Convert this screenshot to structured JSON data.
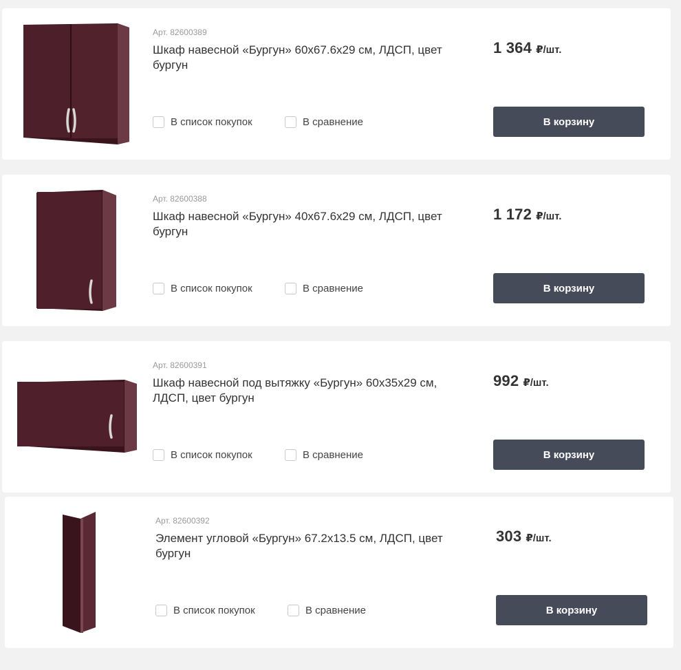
{
  "currency_unit": "₽/шт.",
  "colors": {
    "button_bg": "#464b5a",
    "cabinet": "#4a1e28",
    "page_bg": "#f2f2f2"
  },
  "products": [
    {
      "sku": "Арт. 82600389",
      "title": "Шкаф навесной «Бургун» 60x67.6x29 см, ЛДСП, цвет бургун",
      "price": "1 364",
      "unit": "₽/шт.",
      "shopping_list_label": "В список покупок",
      "compare_label": "В сравнение",
      "cart_button_label": "В корзину",
      "image_icon": "wall-cabinet-double-door-icon"
    },
    {
      "sku": "Арт. 82600388",
      "title": "Шкаф навесной «Бургун» 40x67.6x29 см, ЛДСП, цвет бургун",
      "price": "1 172",
      "unit": "₽/шт.",
      "shopping_list_label": "В список покупок",
      "compare_label": "В сравнение",
      "cart_button_label": "В корзину",
      "image_icon": "wall-cabinet-single-door-icon"
    },
    {
      "sku": "Арт. 82600391",
      "title": "Шкаф навесной под вытяжку «Бургун» 60x35x29 см, ЛДСП, цвет бургун",
      "price": "992",
      "unit": "₽/шт.",
      "shopping_list_label": "В список покупок",
      "compare_label": "В сравнение",
      "cart_button_label": "В корзину",
      "image_icon": "hood-cabinet-icon"
    },
    {
      "sku": "Арт. 82600392",
      "title": "Элемент угловой «Бургун» 67.2x13.5 см, ЛДСП, цвет бургун",
      "price": "303",
      "unit": "₽/шт.",
      "shopping_list_label": "В список покупок",
      "compare_label": "В сравнение",
      "cart_button_label": "В корзину",
      "image_icon": "corner-element-icon"
    }
  ]
}
